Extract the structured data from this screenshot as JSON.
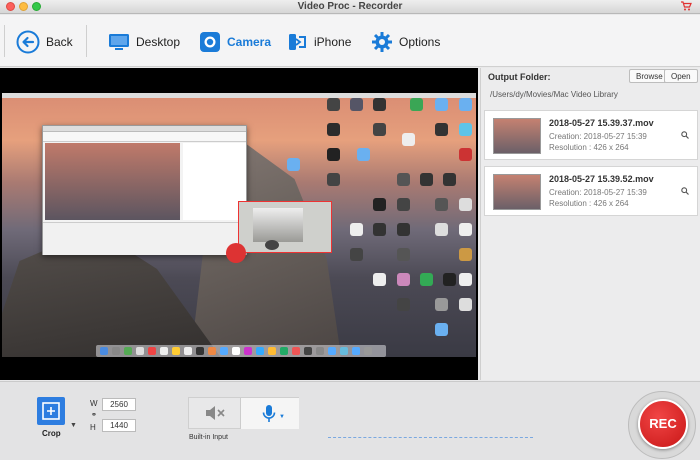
{
  "window": {
    "title": "Video Proc - Recorder",
    "cart_icon": "cart-icon"
  },
  "toolbar": {
    "back_label": "Back",
    "desktop_label": "Desktop",
    "camera_label": "Camera",
    "iphone_label": "iPhone",
    "options_label": "Options",
    "accent": "#1a7bd8"
  },
  "panel": {
    "output_label": "Output Folder:",
    "browse_label": "Browse",
    "open_label": "Open",
    "path": "/Users/dy/Movies/Mac Video Library",
    "files": [
      {
        "name": "2018-05-27 15.39.37.mov",
        "creation": "Creation: 2018-05-27 15:39",
        "resolution": "Resolution : 426 x 264"
      },
      {
        "name": "2018-05-27 15.39.52.mov",
        "creation": "Creation: 2018-05-27 15:39",
        "resolution": "Resolution : 426 x 264"
      }
    ]
  },
  "bottom": {
    "crop_label": "Crop",
    "w_label": "W",
    "h_label": "H",
    "width_value": "2560",
    "height_value": "1440",
    "input_label": "Built-in Input",
    "rec_label": "REC",
    "rec_color": "#d91c1c"
  }
}
